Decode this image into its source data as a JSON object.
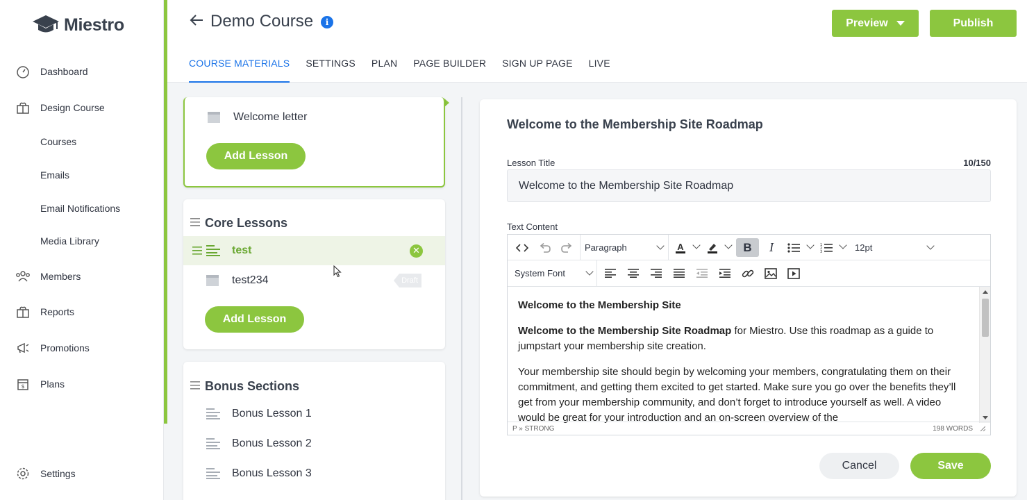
{
  "app": {
    "name": "Miestro"
  },
  "sidebar": {
    "items": [
      {
        "label": "Dashboard",
        "icon": "dashboard-icon"
      },
      {
        "label": "Design Course",
        "icon": "design-course-icon"
      },
      {
        "label": "Courses"
      },
      {
        "label": "Emails"
      },
      {
        "label": "Email Notifications"
      },
      {
        "label": "Media Library"
      },
      {
        "label": "Members",
        "icon": "members-icon"
      },
      {
        "label": "Reports",
        "icon": "reports-icon"
      },
      {
        "label": "Promotions",
        "icon": "megaphone-icon"
      },
      {
        "label": "Plans",
        "icon": "plans-icon"
      },
      {
        "label": "Settings",
        "icon": "gear-icon"
      }
    ]
  },
  "header": {
    "title": "Demo Course",
    "info": "i",
    "preview_label": "Preview",
    "publish_label": "Publish",
    "tabs": [
      {
        "label": "COURSE MATERIALS",
        "active": true
      },
      {
        "label": "SETTINGS"
      },
      {
        "label": "PLAN"
      },
      {
        "label": "PAGE BUILDER"
      },
      {
        "label": "SIGN UP PAGE"
      },
      {
        "label": "LIVE"
      }
    ]
  },
  "sections": [
    {
      "title": "",
      "lessons": [
        {
          "title": "Welcome letter"
        }
      ],
      "add_label": "Add Lesson"
    },
    {
      "title": "Core Lessons",
      "lessons": [
        {
          "title": "test",
          "active": true
        },
        {
          "title": "test234",
          "badge": "Draft"
        }
      ],
      "add_label": "Add Lesson"
    },
    {
      "title": "Bonus Sections",
      "lessons": [
        {
          "title": "Bonus Lesson 1"
        },
        {
          "title": "Bonus Lesson 2"
        },
        {
          "title": "Bonus Lesson 3"
        }
      ]
    }
  ],
  "editor": {
    "heading": "Welcome to the Membership Site Roadmap",
    "lesson_title_label": "Lesson Title",
    "counter": "10/150",
    "lesson_title_value": "Welcome to the Membership Site Roadmap",
    "text_content_label": "Text Content",
    "toolbar": {
      "block_format": "Paragraph",
      "font_family": "System Font",
      "font_size": "12pt"
    },
    "content": {
      "p1": "Welcome to the Membership Site",
      "p2_strong": "Welcome to the Membership Site Roadmap",
      "p2_rest": " for Miestro. Use this roadmap as a guide to jumpstart your membership site creation.",
      "p3": "Your membership site should begin by welcoming your members, congratulating them on their commitment, and getting them excited to get started. Make sure you go over the benefits they’ll get from your membership community, and don’t forget to introduce yourself as well. A video would be great for your introduction and an on-screen overview of the"
    },
    "status_path": "P » STRONG",
    "word_count": "198 WORDS",
    "cancel_label": "Cancel",
    "save_label": "Save"
  },
  "colors": {
    "accent_green": "#8cc63f",
    "link_blue": "#1a73e8"
  }
}
